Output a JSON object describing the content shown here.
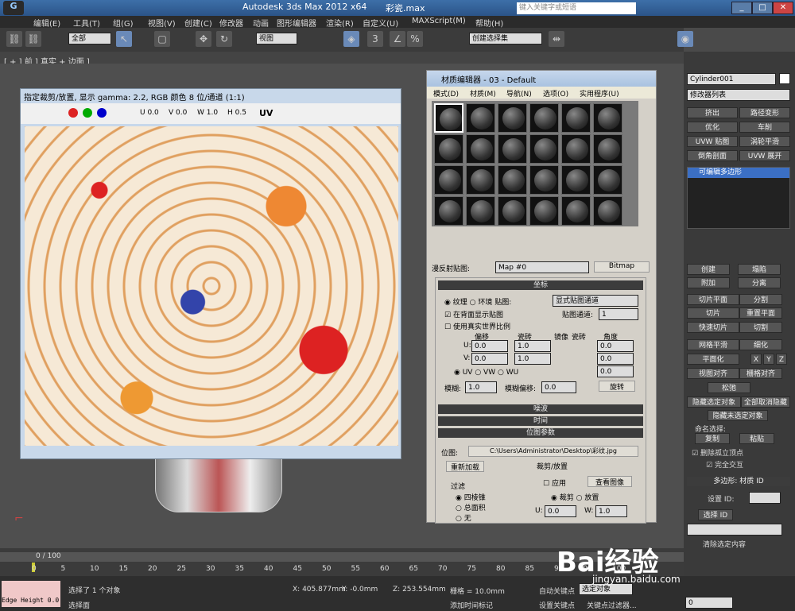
{
  "app": {
    "title": "Autodesk 3ds Max  2012 x64",
    "file": "彩瓷.max",
    "search_placeholder": "键入关键字或短语"
  },
  "menu": [
    "编辑(E)",
    "工具(T)",
    "组(G)",
    "视图(V)",
    "创建(C)",
    "修改器",
    "动画",
    "图形编辑器",
    "渲染(R)",
    "自定义(U)",
    "MAXScript(M)",
    "帮助(H)"
  ],
  "toolbar": {
    "filter": "全部",
    "view": "视图",
    "selset": "创建选择集"
  },
  "viewport_label": "[ + ] 前 ] 真实 + 边面 ]",
  "frame": {
    "title": "指定裁剪/放置, 显示 gamma: 2.2, RGB 颜色 8 位/通道 (1:1)",
    "u": "0.0",
    "v": "0.0",
    "w": "1.0",
    "h": "0.5",
    "uv": "UV"
  },
  "mat": {
    "title": "材质编辑器 - 03 - Default",
    "menus": [
      "模式(D)",
      "材质(M)",
      "导航(N)",
      "选项(O)",
      "实用程序(U)"
    ],
    "map_label": "漫反射贴图:",
    "map_name": "Map #0",
    "map_type": "Bitmap",
    "coords": "坐标",
    "texture": "纹理",
    "env": "环境",
    "mapping_label": "贴图:",
    "mapping": "显式贴图通道",
    "show_back": "在背面显示贴图",
    "channel_label": "贴图通道:",
    "channel": "1",
    "real_world": "使用真实世界比例",
    "offset": "偏移",
    "tiling": "瓷砖",
    "mirror": "镜像",
    "tile": "瓷砖",
    "angle": "角度",
    "u_off": "0.0",
    "v_off": "0.0",
    "u_til": "1.0",
    "v_til": "1.0",
    "u_ang": "0.0",
    "v_ang": "0.0",
    "w_ang": "0.0",
    "uv": "UV",
    "vw": "VW",
    "wu": "WU",
    "blur": "模糊:",
    "blur_v": "1.0",
    "blur_off": "模糊偏移:",
    "blur_off_v": "0.0",
    "rotate": "旋转",
    "noise": "噪波",
    "time": "时间",
    "bitmap_params": "位图参数",
    "bitmap_label": "位图:",
    "bitmap_path": "C:\\Users\\Administrator\\Desktop\\彩纹.jpg",
    "reload": "重新加载",
    "crop": "裁剪/放置",
    "apply": "应用",
    "view_img": "查看图像",
    "crop_opt": "裁剪",
    "place_opt": "放置",
    "filter": "过滤",
    "f1": "四棱锥",
    "f2": "总面积",
    "f3": "无",
    "cu": "0.0",
    "cw": "1.0"
  },
  "right": {
    "object": "Cylinder001",
    "modlist": "修改器列表",
    "mods": [
      "挤出",
      "路径变形",
      "优化",
      "车削",
      "UVW 贴图",
      "涡轮平滑",
      "倒角剖面",
      "UVW 展开"
    ],
    "stack": "可编辑多边形",
    "edit": [
      "创建",
      "塌陷",
      "附加",
      "分离",
      "切片平面",
      "分割",
      "切片",
      "重置平面",
      "快速切片",
      "切割",
      "网格平滑",
      "细化",
      "平面化",
      "X",
      "Y",
      "Z",
      "视图对齐",
      "栅格对齐",
      "松弛"
    ],
    "hide_sel": "隐藏选定对象",
    "unhide": "全部取消隐藏",
    "hide_unsel": "隐藏未选定对象",
    "named_sel": "命名选择:",
    "copy": "复制",
    "paste": "粘贴",
    "del_iso": "删除孤立顶点",
    "full": "完全交互",
    "poly_mat": "多边形: 材质 ID",
    "set_id": "设置 ID:",
    "select_id": "选择 ID",
    "clear_sel": "清除选定内容"
  },
  "timeline": {
    "frame": "0 / 100",
    "ticks": [
      "0",
      "5",
      "10",
      "15",
      "20",
      "25",
      "30",
      "35",
      "40",
      "45",
      "50",
      "55",
      "60",
      "65",
      "70",
      "75",
      "80",
      "85",
      "90",
      "95",
      "100"
    ]
  },
  "status": {
    "edge": "Edge Height 0.0",
    "msg1": "选择了 1 个对象",
    "msg2": "选择面",
    "x": "405.877mm",
    "y": "-0.0mm",
    "z": "253.554mm",
    "grid": "栅格 = 10.0mm",
    "autokey": "自动关键点",
    "setkey": "设置关键点",
    "sel": "选定对象",
    "filter": "关键点过滤器...",
    "addtime": "添加时间标记",
    "frame": "0"
  },
  "watermark": "Bai经验",
  "watermark_url": "jingyan.baidu.com"
}
